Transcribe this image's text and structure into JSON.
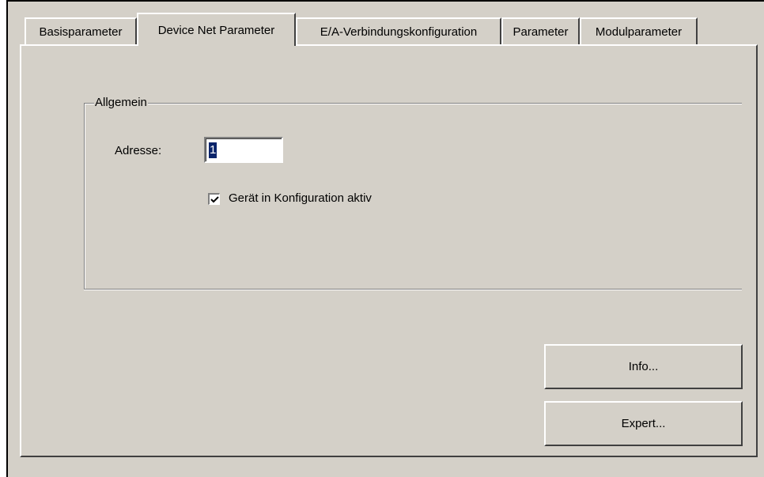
{
  "tabs": [
    {
      "label": "Basisparameter",
      "active": false
    },
    {
      "label": "Device Net Parameter",
      "active": true
    },
    {
      "label": "E/A-Verbindungskonfiguration",
      "active": false
    },
    {
      "label": "Parameter",
      "active": false
    },
    {
      "label": "Modulparameter",
      "active": false
    }
  ],
  "group": {
    "title": "Allgemein",
    "address_label": "Adresse:",
    "address_value": "1",
    "checkbox_label": "Gerät in Konfiguration aktiv",
    "checkbox_checked": true
  },
  "buttons": {
    "info_label": "Info...",
    "expert_label": "Expert..."
  },
  "colors": {
    "face": "#d4d0c8",
    "selection": "#0a246a"
  }
}
